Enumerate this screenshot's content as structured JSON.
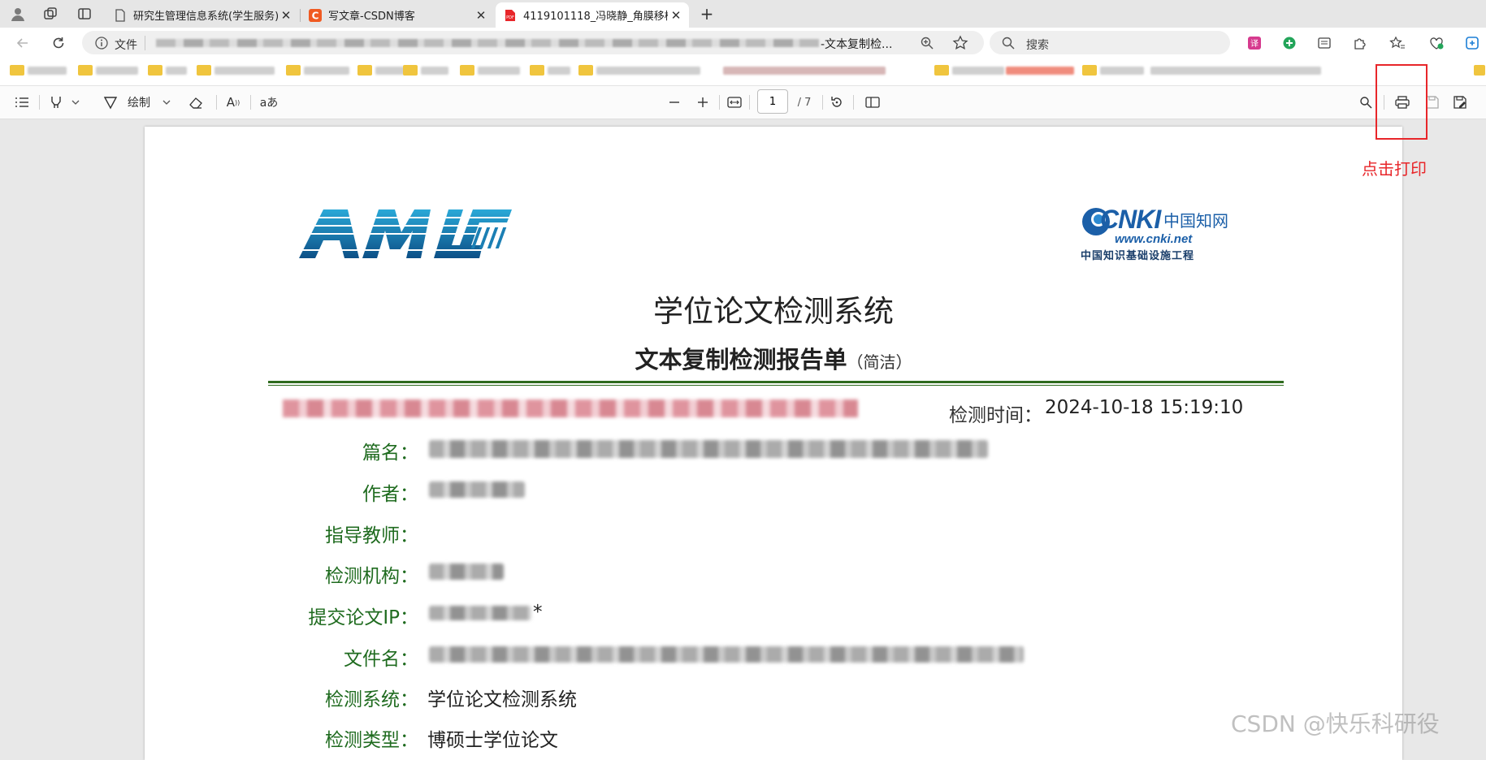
{
  "tabs": [
    {
      "title": "研究生管理信息系统(学生服务)",
      "active": false
    },
    {
      "title": "写文章-CSDN博客",
      "active": false
    },
    {
      "title": "4119101118_冯晓静_角膜移植手术...",
      "active": true
    }
  ],
  "new_tab": "+",
  "address": {
    "scheme_label": "文件",
    "url_tail": "-文本复制检..."
  },
  "search": {
    "placeholder": "搜索"
  },
  "pdf_toolbar": {
    "draw_label": "绘制",
    "text_tool_label": "aあ",
    "read_aloud_label": "A",
    "page_current": "1",
    "page_total": "/ 7"
  },
  "document": {
    "system_title": "学位论文检测系统",
    "report_title": "文本复制检测报告单",
    "report_subtitle": "（简洁）",
    "detect_time_label": "检测时间：",
    "detect_time_value": "2024-10-18 15:19:10",
    "cnki": {
      "brand": "CNKI",
      "cn_name": "中国知网",
      "url": "www.cnki.net",
      "tagline": "中国知识基础设施工程"
    },
    "fields": [
      {
        "label": "篇名：",
        "value": ""
      },
      {
        "label": "作者：",
        "value": ""
      },
      {
        "label": "指导教师：",
        "value": ""
      },
      {
        "label": "检测机构：",
        "value": ""
      },
      {
        "label": "提交论文IP：",
        "value": "*"
      },
      {
        "label": "文件名：",
        "value": ""
      },
      {
        "label": "检测系统：",
        "value": "学位论文检测系统"
      },
      {
        "label": "检测类型：",
        "value": "博硕士学位论文"
      }
    ]
  },
  "annotation": {
    "text": "点击打印"
  },
  "watermark": "CSDN @快乐科研役",
  "colors": {
    "annotation_red": "#e8262a",
    "label_green": "#1f6b1f",
    "rule_green": "#2e6b1e",
    "logo_blue": "#1b7fb4"
  }
}
